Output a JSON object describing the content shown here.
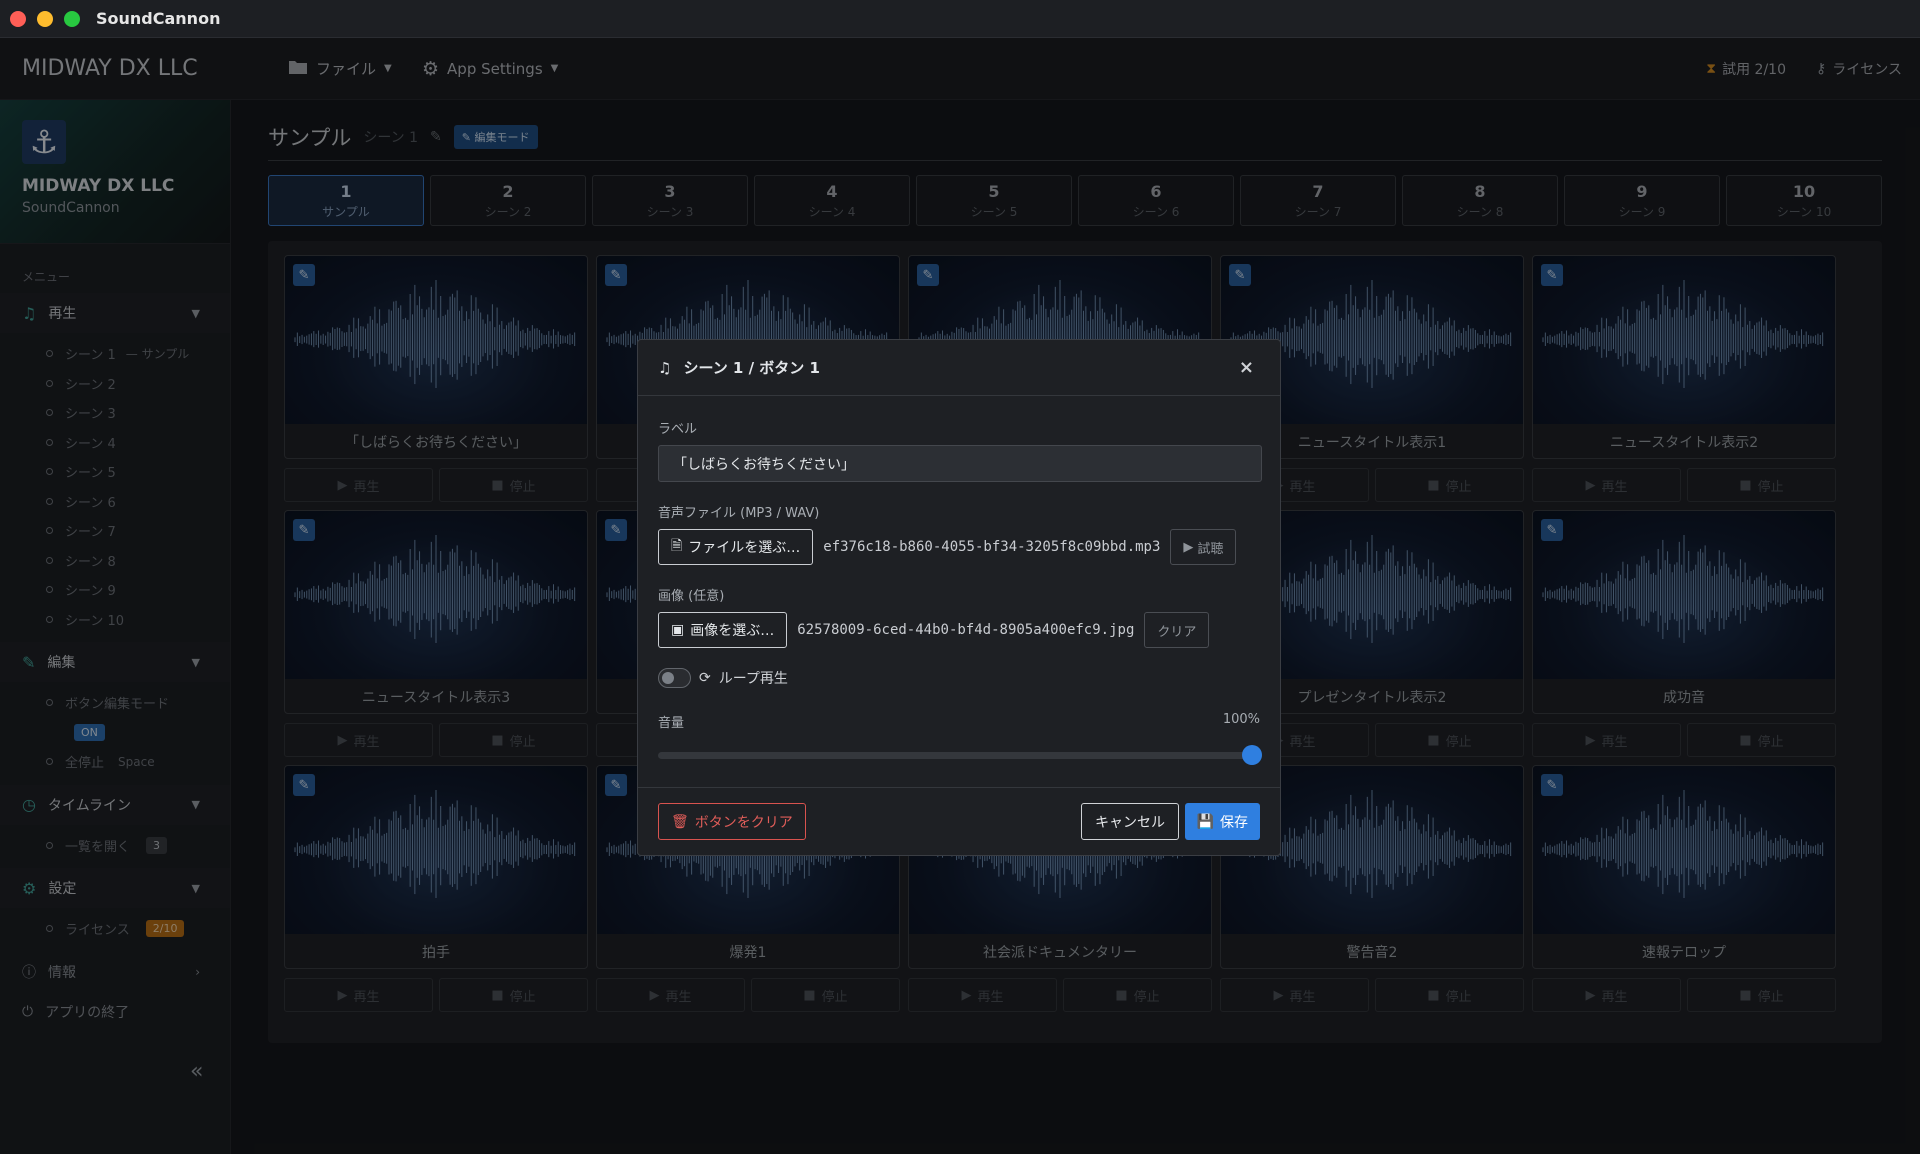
{
  "window": {
    "title": "SoundCannon"
  },
  "navbar": {
    "brand": "MIDWAY DX LLC",
    "file_menu": "ファイル",
    "settings_menu": "App Settings",
    "trial": "試用 2/10",
    "license": "ライセンス"
  },
  "sidebar": {
    "company": "MIDWAY DX LLC",
    "app": "SoundCannon",
    "menu_label": "メニュー",
    "play_section": "再生",
    "scenes": [
      {
        "label": "シーン 1",
        "note": "— サンプル"
      },
      {
        "label": "シーン 2",
        "note": ""
      },
      {
        "label": "シーン 3",
        "note": ""
      },
      {
        "label": "シーン 4",
        "note": ""
      },
      {
        "label": "シーン 5",
        "note": ""
      },
      {
        "label": "シーン 6",
        "note": ""
      },
      {
        "label": "シーン 7",
        "note": ""
      },
      {
        "label": "シーン 8",
        "note": ""
      },
      {
        "label": "シーン 9",
        "note": ""
      },
      {
        "label": "シーン 10",
        "note": ""
      }
    ],
    "edit_section": "編集",
    "edit_mode": "ボタン編集モード",
    "edit_mode_badge": "ON",
    "stop_all": "全停止",
    "stop_all_key": "Space",
    "timeline_section": "タイムライン",
    "timeline_open": "一覧を開く",
    "timeline_count": "3",
    "settings_section": "設定",
    "license_item": "ライセンス",
    "license_badge": "2/10",
    "info": "情報",
    "quit": "アプリの終了",
    "collapse": "«"
  },
  "main": {
    "title": "サンプル",
    "subtitle": "シーン 1",
    "edit_badge": "編集モード",
    "tabs": [
      {
        "num": "1",
        "label": "サンプル"
      },
      {
        "num": "2",
        "label": "シーン 2"
      },
      {
        "num": "3",
        "label": "シーン 3"
      },
      {
        "num": "4",
        "label": "シーン 4"
      },
      {
        "num": "5",
        "label": "シーン 5"
      },
      {
        "num": "6",
        "label": "シーン 6"
      },
      {
        "num": "7",
        "label": "シーン 7"
      },
      {
        "num": "8",
        "label": "シーン 8"
      },
      {
        "num": "9",
        "label": "シーン 9"
      },
      {
        "num": "10",
        "label": "シーン 10"
      }
    ],
    "play_label": "再生",
    "stop_label": "停止",
    "cards": [
      "「しばらくお待ちください」",
      "",
      "",
      "ニュースタイトル表示1",
      "ニュースタイトル表示2",
      "ニュースタイトル表示3",
      "",
      "",
      "プレゼンタイトル表示2",
      "成功音",
      "拍手",
      "爆発1",
      "社会派ドキュメンタリー",
      "警告音2",
      "速報テロップ"
    ]
  },
  "modal": {
    "title": "シーン 1 / ボタン 1",
    "label_field_label": "ラベル",
    "label_value": "「しばらくお待ちください」",
    "audio_label": "音声ファイル (MP3 / WAV)",
    "audio_choose": "ファイルを選ぶ…",
    "audio_file": "ef376c18-b860-4055-bf34-3205f8c09bbd.mp3",
    "audio_preview": "試聴",
    "image_label": "画像 (任意)",
    "image_choose": "画像を選ぶ…",
    "image_file": "62578009-6ced-44b0-bf4d-8905a400efc9.jpg",
    "image_clear": "クリア",
    "loop_label": "ループ再生",
    "loop_on": false,
    "volume_label": "音量",
    "volume_value": "100%",
    "volume_fraction": 1.0,
    "clear_button": "ボタンをクリア",
    "cancel_button": "キャンセル",
    "save_button": "保存"
  },
  "colors": {
    "accent": "#2f7fe0",
    "danger": "#d9534f",
    "teal": "#43a39a",
    "traffic_close": "#ff5f57",
    "traffic_min": "#febc2e",
    "traffic_max": "#28c840"
  }
}
